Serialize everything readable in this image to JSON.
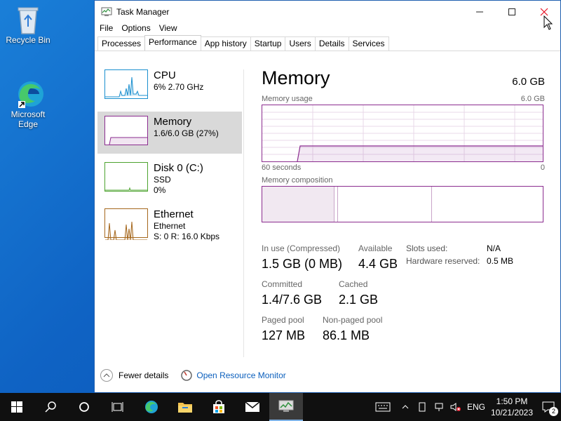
{
  "desktop": {
    "recycle_bin": "Recycle Bin",
    "edge_line1": "Microsoft",
    "edge_line2": "Edge"
  },
  "window": {
    "title": "Task Manager",
    "icon": "task-manager-icon"
  },
  "menu": [
    "File",
    "Options",
    "View"
  ],
  "tabs": [
    "Processes",
    "Performance",
    "App history",
    "Startup",
    "Users",
    "Details",
    "Services"
  ],
  "active_tab": "Performance",
  "sidebar": {
    "items": [
      {
        "title": "CPU",
        "line1": "6% 2.70 GHz",
        "line2": "",
        "color": "#1a8fcf"
      },
      {
        "title": "Memory",
        "line1": "1.6/6.0 GB (27%)",
        "line2": "",
        "color": "#8b2c8f"
      },
      {
        "title": "Disk 0 (C:)",
        "line1": "SSD",
        "line2": "0%",
        "color": "#4da32f"
      },
      {
        "title": "Ethernet",
        "line1": "Ethernet",
        "line2": "S: 0 R: 16.0 Kbps",
        "color": "#a5671c"
      }
    ]
  },
  "memory": {
    "heading": "Memory",
    "total": "6.0 GB",
    "usage_label": "Memory usage",
    "usage_max": "6.0 GB",
    "axis_left": "60 seconds",
    "axis_right": "0",
    "usage_fraction": 0.27,
    "composition_label": "Memory composition",
    "in_use_label": "In use (Compressed)",
    "in_use_value": "1.5 GB (0 MB)",
    "available_label": "Available",
    "available_value": "4.4 GB",
    "committed_label": "Committed",
    "committed_value": "1.4/7.6 GB",
    "cached_label": "Cached",
    "cached_value": "2.1 GB",
    "paged_label": "Paged pool",
    "paged_value": "127 MB",
    "nonpaged_label": "Non-paged pool",
    "nonpaged_value": "86.1 MB",
    "slots_label": "Slots used:",
    "slots_value": "N/A",
    "hw_reserved_label": "Hardware reserved:",
    "hw_reserved_value": "0.5 MB"
  },
  "footer": {
    "fewer_details": "Fewer details",
    "resource_monitor": "Open Resource Monitor"
  },
  "taskbar": {
    "lang": "ENG",
    "time": "1:50 PM",
    "date": "10/21/2023",
    "notifications": "2"
  },
  "colors": {
    "memory": "#8b2c8f",
    "taskbar": "#101010",
    "link": "#0b5fbd"
  }
}
